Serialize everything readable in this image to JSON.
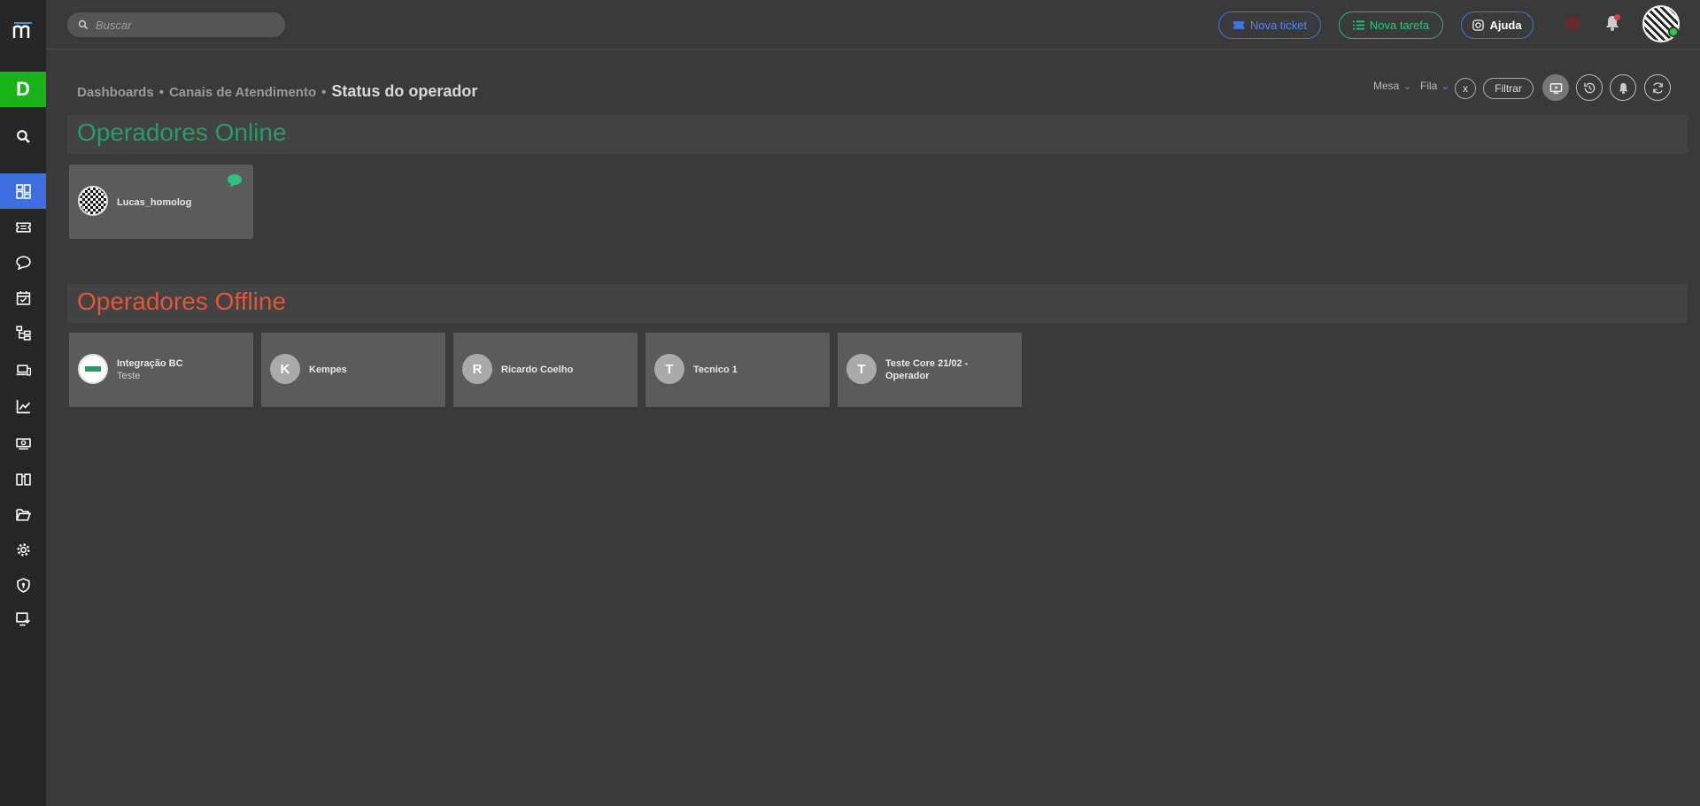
{
  "search": {
    "placeholder": "Buscar"
  },
  "workspace": {
    "initial": "D"
  },
  "topbar": {
    "new_ticket": "Nova ticket",
    "new_task": "Nova tarefa",
    "help": "Ajuda"
  },
  "breadcrumb": {
    "items": [
      "Dashboards",
      "Canais de Atendimento"
    ],
    "separator": "•",
    "current": "Status do operador"
  },
  "filters": {
    "mesa": "Mesa",
    "fila": "Fila",
    "clear": "x",
    "apply": "Filtrar"
  },
  "sidebar": {
    "items": [
      "dashboard-icon",
      "ticket-icon",
      "chat-icon",
      "calendar-icon",
      "hierarchy-icon",
      "devices-icon",
      "chart-icon",
      "money-icon",
      "book-icon",
      "folder-icon",
      "gear-icon",
      "shield-icon",
      "download-icon"
    ],
    "active": "dashboard-icon"
  },
  "sections": {
    "online": {
      "title": "Operadores Online",
      "operators": [
        {
          "name": "Lucas_homolog",
          "avatar": "qr",
          "chat": true
        }
      ]
    },
    "offline": {
      "title": "Operadores Offline",
      "operators": [
        {
          "name": "Integração BC",
          "subtitle": "Teste",
          "avatar": "image"
        },
        {
          "name": "Kempes",
          "initial": "K"
        },
        {
          "name": "Ricardo Coelho",
          "initial": "R"
        },
        {
          "name": "Tecnico 1",
          "initial": "T"
        },
        {
          "name": "Teste Core 21/02 - Operador",
          "initial": "T"
        }
      ]
    }
  },
  "colors": {
    "online": "#2a9a66",
    "offline": "#e0573a",
    "accent": "#3d6fe0",
    "workspace": "#19b319"
  }
}
